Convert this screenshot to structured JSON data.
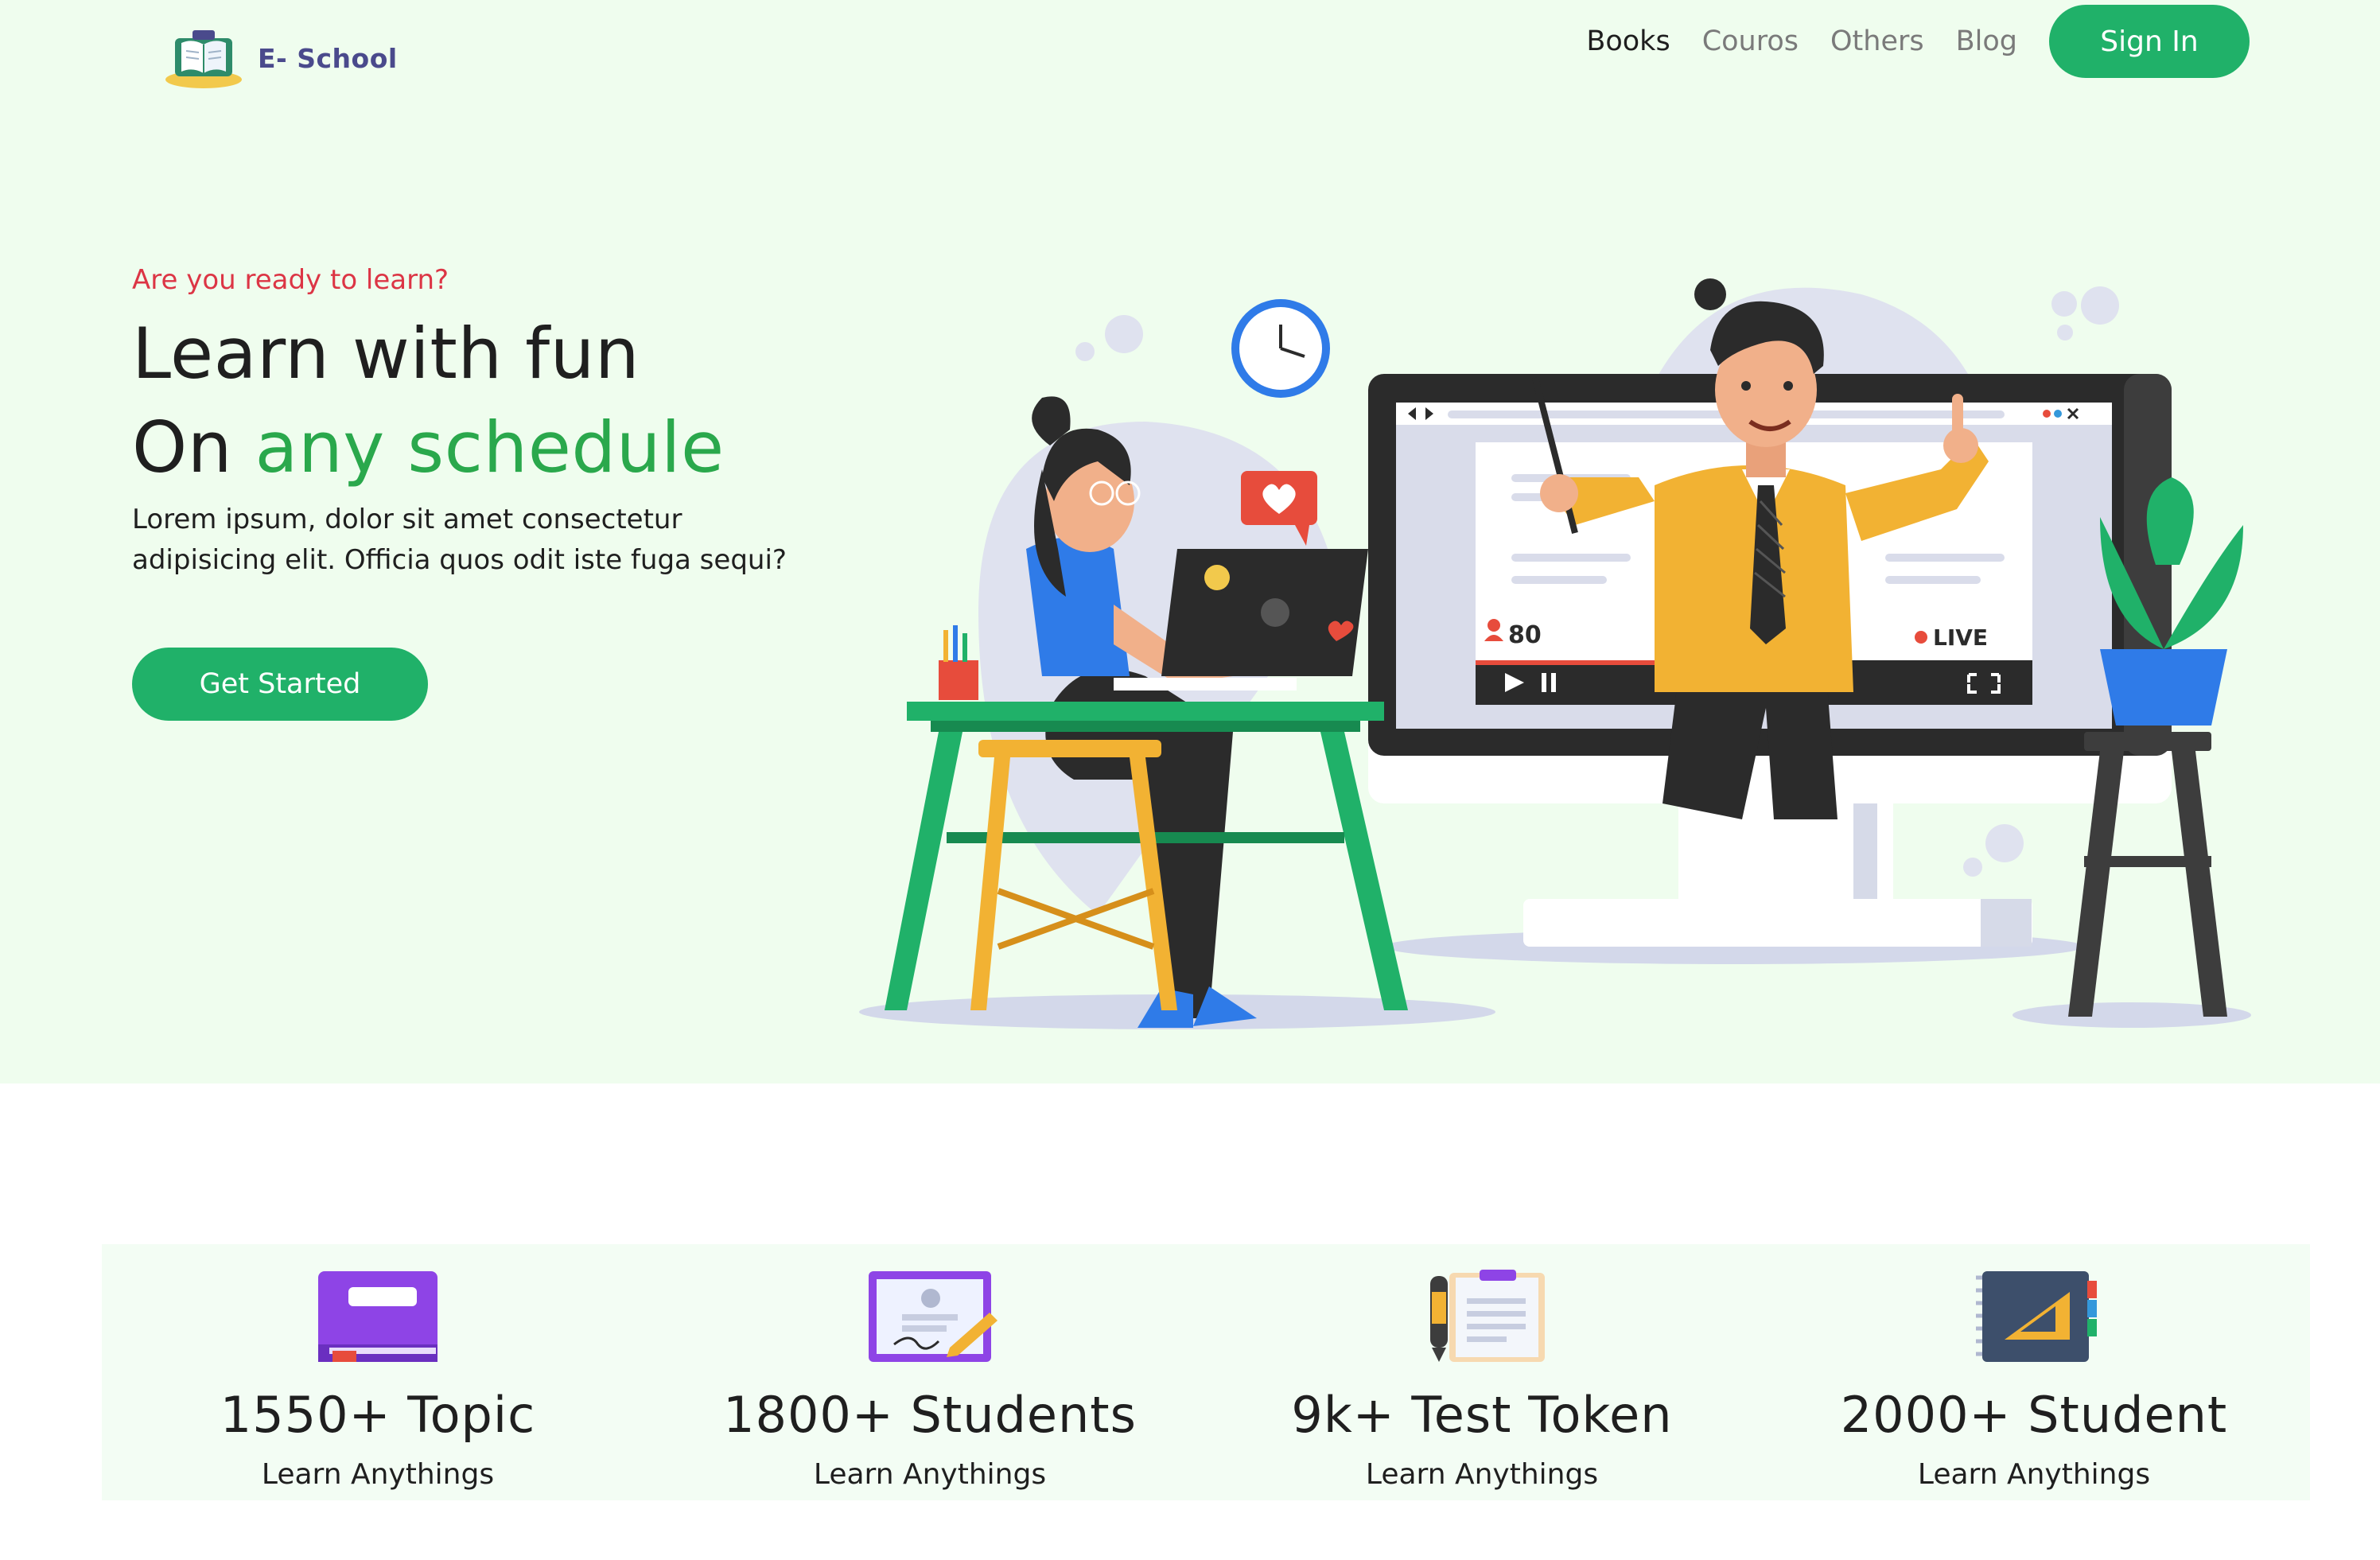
{
  "brand": {
    "name": "E- School"
  },
  "nav": {
    "links": [
      "Books",
      "Couros",
      "Others",
      "Blog"
    ],
    "signin": "Sign In"
  },
  "hero": {
    "eyebrow": "Are you ready to learn?",
    "line1": "Learn with fun",
    "line2_prefix": "On ",
    "line2_accent": "any schedule",
    "lead": "Lorem ipsum, dolor sit amet consectetur adipisicing elit. Officia quos odit iste fuga sequi?",
    "cta": "Get Started",
    "viewers": "80",
    "live": "LIVE"
  },
  "stats": [
    {
      "value": "1550+ Topic",
      "label": "Learn Anythings",
      "icon": "book-icon"
    },
    {
      "value": "1800+ Students",
      "label": "Learn Anythings",
      "icon": "certificate-icon"
    },
    {
      "value": "9k+ Test Token",
      "label": "Learn Anythings",
      "icon": "clipboard-icon"
    },
    {
      "value": "2000+ Student",
      "label": "Learn Anythings",
      "icon": "notebook-icon"
    }
  ],
  "colors": {
    "brand_green": "#20b169",
    "accent_green": "#2aa84c",
    "eyebrow_red": "#dc3545",
    "hero_bg": "#effdee"
  }
}
